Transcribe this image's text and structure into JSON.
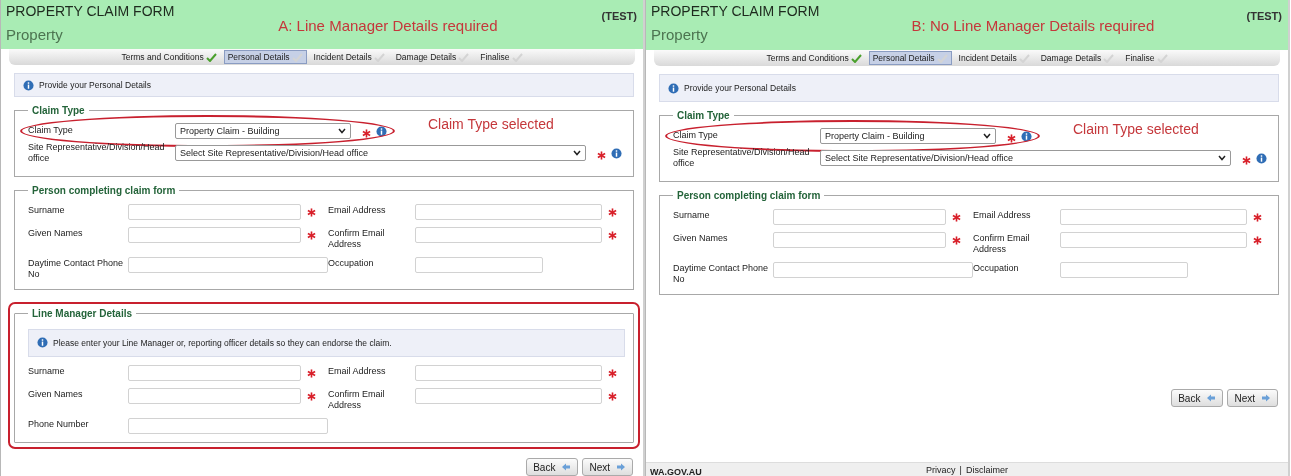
{
  "panels": [
    {
      "header": {
        "title": "PROPERTY CLAIM FORM",
        "subtitle": "Property",
        "environment": "(TEST)",
        "annotation": "A: Line Manager Details required"
      },
      "steps": [
        {
          "label": "Terms and Conditions",
          "selected": false,
          "done": true
        },
        {
          "label": "Personal Details",
          "selected": true,
          "done": false
        },
        {
          "label": "Incident Details",
          "selected": false,
          "done": false
        },
        {
          "label": "Damage Details",
          "selected": false,
          "done": false
        },
        {
          "label": "Finalise",
          "selected": false,
          "done": false
        }
      ],
      "notice": "Provide your Personal Details",
      "sections": [
        {
          "kind": "list",
          "legend": "Claim Type",
          "highlighted": false,
          "fields": [
            {
              "label": "Claim Type",
              "kind": "select",
              "value": "Property Claim - Building",
              "required": true,
              "info": true,
              "highlighted": true,
              "annotation": "Claim Type selected"
            },
            {
              "label": "Site Representative/Division/Head office",
              "kind": "select",
              "value": "Select Site Representative/Division/Head office",
              "required": true,
              "info": true,
              "highlighted": false
            }
          ]
        },
        {
          "kind": "grid",
          "legend": "Person completing claim form",
          "highlighted": false,
          "fields": [
            {
              "label": "Surname",
              "kind": "text",
              "required": true
            },
            {
              "label": "Email Address",
              "kind": "text",
              "required": true
            },
            {
              "label": "Given Names",
              "kind": "text",
              "required": true
            },
            {
              "label": "Confirm Email Address",
              "kind": "text",
              "required": true
            },
            {
              "label": "Daytime Contact Phone No",
              "kind": "text",
              "required": false
            },
            {
              "label": "Occupation",
              "kind": "text",
              "required": false
            }
          ]
        },
        {
          "kind": "grid",
          "legend": "Line Manager Details",
          "highlighted": true,
          "notice": "Please enter your Line Manager or, reporting officer details so they can endorse the claim.",
          "fields": [
            {
              "label": "Surname",
              "kind": "text",
              "required": true
            },
            {
              "label": "Email Address",
              "kind": "text",
              "required": true
            },
            {
              "label": "Given Names",
              "kind": "text",
              "required": true
            },
            {
              "label": "Confirm Email Address",
              "kind": "text",
              "required": true
            },
            {
              "label": "Phone Number",
              "kind": "text",
              "required": false
            }
          ]
        }
      ],
      "buttons": [
        {
          "label": "Back",
          "kind": "back"
        },
        {
          "label": "Next",
          "kind": "next"
        }
      ]
    },
    {
      "header": {
        "title": "PROPERTY CLAIM FORM",
        "subtitle": "Property",
        "environment": "(TEST)",
        "annotation": "B: No Line Manager Details required"
      },
      "steps": [
        {
          "label": "Terms and Conditions",
          "selected": false,
          "done": true
        },
        {
          "label": "Personal Details",
          "selected": true,
          "done": false
        },
        {
          "label": "Incident Details",
          "selected": false,
          "done": false
        },
        {
          "label": "Damage Details",
          "selected": false,
          "done": false
        },
        {
          "label": "Finalise",
          "selected": false,
          "done": false
        }
      ],
      "notice": "Provide your Personal Details",
      "sections": [
        {
          "kind": "list",
          "legend": "Claim Type",
          "highlighted": false,
          "fields": [
            {
              "label": "Claim Type",
              "kind": "select",
              "value": "Property Claim - Building",
              "required": true,
              "info": true,
              "highlighted": true,
              "annotation": "Claim Type selected"
            },
            {
              "label": "Site Representative/Division/Head office",
              "kind": "select",
              "value": "Select Site Representative/Division/Head office",
              "required": true,
              "info": true,
              "highlighted": false
            }
          ]
        },
        {
          "kind": "grid",
          "legend": "Person completing claim form",
          "highlighted": false,
          "fields": [
            {
              "label": "Surname",
              "kind": "text",
              "required": true
            },
            {
              "label": "Email Address",
              "kind": "text",
              "required": true
            },
            {
              "label": "Given Names",
              "kind": "text",
              "required": true
            },
            {
              "label": "Confirm Email Address",
              "kind": "text",
              "required": true
            },
            {
              "label": "Daytime Contact Phone No",
              "kind": "text",
              "required": false
            },
            {
              "label": "Occupation",
              "kind": "text",
              "required": false
            }
          ]
        }
      ],
      "buttons": [
        {
          "label": "Back",
          "kind": "back"
        },
        {
          "label": "Next",
          "kind": "next"
        }
      ],
      "footer": {
        "brand": "WA.GOV.AU",
        "links": [
          "Privacy",
          "Disclaimer"
        ],
        "separator": "|"
      }
    }
  ]
}
